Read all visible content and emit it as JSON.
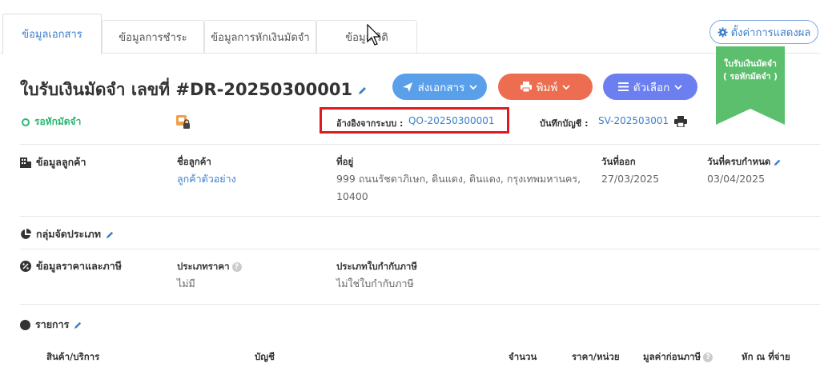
{
  "tabs": [
    {
      "label": "ข้อมูลเอกสาร"
    },
    {
      "label": "ข้อมูลการชำระ"
    },
    {
      "label": "ข้อมูลการหักเงินมัดจำ"
    },
    {
      "label": "ข้อมูลเวิติ"
    }
  ],
  "settings_label": "ตั้งค่าการแสดงผล",
  "ribbon": {
    "line1": "ใบรับเงินมัดจำ",
    "line2": "( รอหักมัดจำ )",
    "color": "#5cbf6e"
  },
  "document": {
    "title": "ใบรับเงินมัดจำ เลขที่ #DR-20250300001",
    "status": "รอหักมัดจำ"
  },
  "actions": {
    "send": "ส่งเอกสาร",
    "print": "พิมพ์",
    "options": "ตัวเลือก"
  },
  "reference": {
    "label": "อ้างอิงจากระบบ :",
    "value": "QO-20250300001"
  },
  "journal": {
    "label": "บันทึกบัญชี :",
    "value": "SV-202503001"
  },
  "customer": {
    "section": "ข้อมูลลูกค้า",
    "name_label": "ชื่อลูกค้า",
    "name": "ลูกค้าตัวอย่าง",
    "address_label": "ที่อยู่",
    "address_line1": "999 ถนนรัชดาภิเษก, ดินแดง, ดินแดง, กรุงเทพมหานคร,",
    "address_line2": "10400",
    "issue_label": "วันที่ออก",
    "issue_date": "27/03/2025",
    "due_label": "วันที่ครบกำหนด",
    "due_date": "03/04/2025"
  },
  "group_section": "กลุ่มจัดประเภท",
  "pricing": {
    "section": "ข้อมูลราคาและภาษี",
    "price_type_label": "ประเภทราคา",
    "price_type": "ไม่มี",
    "tax_invoice_label": "ประเภทใบกำกับภาษี",
    "tax_invoice": "ไม่ใช่ใบกำกับภาษี"
  },
  "items": {
    "section": "รายการ",
    "columns": [
      "สินค้า/บริการ",
      "บัญชี",
      "จำนวน",
      "ราคา/หน่วย",
      "มูลค่าก่อนภาษี",
      "หัก ณ ที่จ่าย"
    ]
  }
}
